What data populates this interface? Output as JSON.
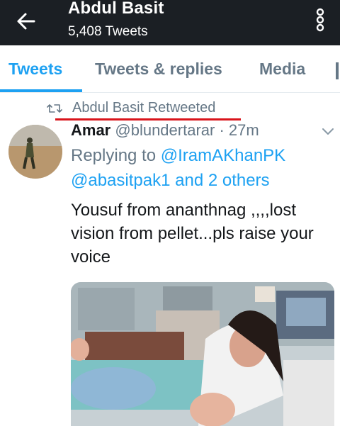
{
  "header": {
    "back_icon": "arrow-left-icon",
    "title": "Abdul Basit",
    "subtitle": "5,408 Tweets",
    "overflow_icon": "more-vertical-icon"
  },
  "tabs": [
    {
      "label": "Tweets",
      "active": true
    },
    {
      "label": "Tweets & replies",
      "active": false
    },
    {
      "label": "Media",
      "active": false
    }
  ],
  "retweet": {
    "icon": "retweet-icon",
    "text": "Abdul Basit Retweeted"
  },
  "tweet": {
    "name": "Amar",
    "handle": "@blundertarar",
    "separator": "·",
    "time": "27m",
    "replying_prefix": "Replying to ",
    "replying_mention": "@IramAKhanPK",
    "replying_mention2": "@abasitpak1",
    "replying_suffix": " and 2 others",
    "text": "Yousuf from ananthnag ,,,,lost vision from pellet...pls raise your voice",
    "menu_icon": "chevron-down-icon"
  },
  "colors": {
    "topbar_bg": "#1b1f24",
    "accent": "#1da1f2",
    "secondary_text": "#657786",
    "annotation_red": "#d9141b"
  }
}
